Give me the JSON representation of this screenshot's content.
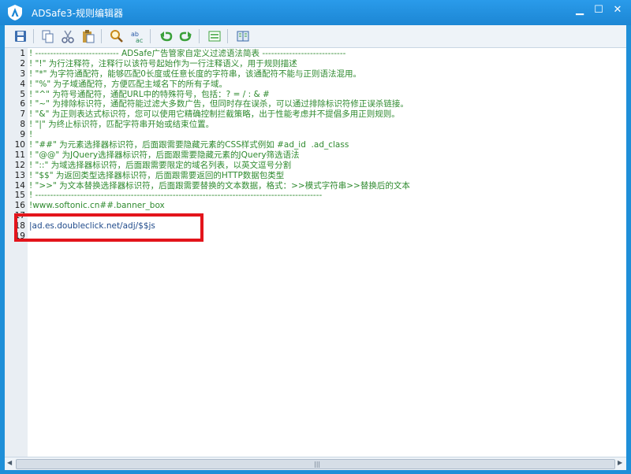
{
  "window": {
    "title": "ADSafe3-规则编辑器",
    "minimize_symbol": "▁",
    "maximize_symbol": "☐",
    "close_symbol": "✕"
  },
  "toolbar": {
    "buttons": [
      "save-icon",
      "copy-icon",
      "cut-icon",
      "paste-icon",
      "find-icon",
      "replace-icon",
      "undo-icon",
      "redo-icon",
      "toggle-view-icon",
      "book-icon"
    ]
  },
  "editor": {
    "lines": [
      {
        "num": "1",
        "text": "! ---------------------------- ADSafe广告管家自定义过滤语法简表 ----------------------------"
      },
      {
        "num": "2",
        "text": "! \"!\" 为行注释符，注释行以该符号起始作为一行注释语义，用于规则描述"
      },
      {
        "num": "3",
        "text": "! \"*\" 为字符通配符，能够匹配0长度或任意长度的字符串，该通配符不能与正则语法混用。"
      },
      {
        "num": "4",
        "text": "! \"%\" 为子域通配符，方便匹配主域名下的所有子域。"
      },
      {
        "num": "5",
        "text": "! \"^\" 为符号通配符，通配URL中的特殊符号，包括：? = / : & #"
      },
      {
        "num": "6",
        "text": "! \"~\" 为排除标识符，通配符能过滤大多数广告，但同时存在误杀，可以通过排除标识符修正误杀链接。"
      },
      {
        "num": "7",
        "text": "! \"&\" 为正则表达式标识符，您可以使用它精确控制拦截策略，出于性能考虑并不提倡多用正则规则。"
      },
      {
        "num": "8",
        "text": "! \"|\" 为终止标识符，匹配字符串开始或结束位置。"
      },
      {
        "num": "9",
        "text": "!"
      },
      {
        "num": "10",
        "text": "! \"##\" 为元素选择器标识符，后面跟需要隐藏元素的CSS样式例如 #ad_id  .ad_class"
      },
      {
        "num": "11",
        "text": "! \"@@\" 为JQuery选择器标识符，后面跟需要隐藏元素的JQuery筛选语法"
      },
      {
        "num": "12",
        "text": "! \"::\" 为域选择器标识符，后面跟需要限定的域名列表，以英文逗号分割"
      },
      {
        "num": "13",
        "text": "! \"$$\" 为返回类型选择器标识符，后面跟需要返回的HTTP数据包类型"
      },
      {
        "num": "14",
        "text": "! \">>\" 为文本替换选择器标识符，后面跟需要替换的文本数据，格式：>>模式字符串>>替换后的文本"
      },
      {
        "num": "15",
        "text": "! ------------------------------------------------------------------------------------------------"
      },
      {
        "num": "16",
        "text": "!www.softonic.cn##.banner_box"
      },
      {
        "num": "17",
        "text": ""
      },
      {
        "num": "18",
        "text": "|ad.es.doubleclick.net/adj/$$js"
      },
      {
        "num": "19",
        "text": ""
      }
    ]
  },
  "scrollbar": {
    "grip": "|||",
    "left_arrow": "◀",
    "right_arrow": "▶"
  },
  "colors": {
    "title_bar": "#1f8fd8",
    "comment": "#2f8a2f",
    "rule": "#1f4a8a",
    "highlight": "#e3141b"
  }
}
